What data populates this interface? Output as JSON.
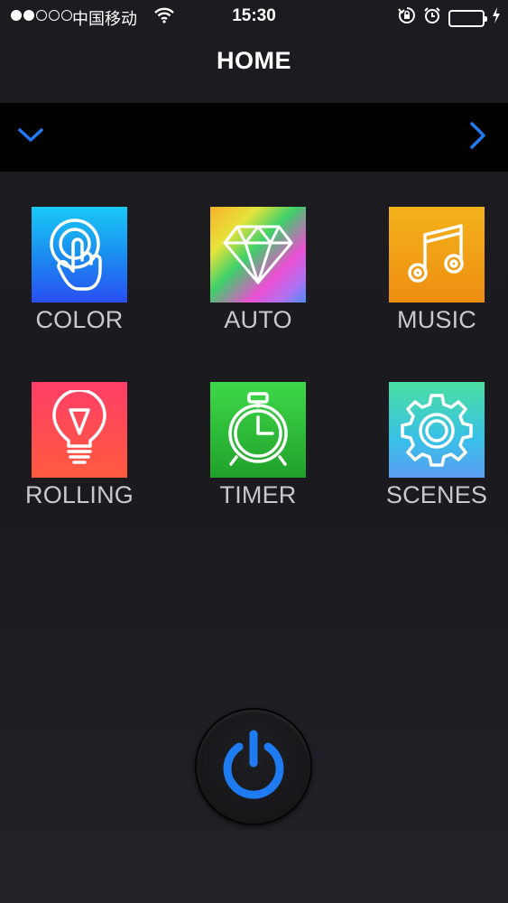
{
  "status_bar": {
    "carrier": "中国移动",
    "time": "15:30"
  },
  "nav": {
    "title": "HOME"
  },
  "tiles": [
    {
      "label": "COLOR",
      "icon": "touch-hand-icon"
    },
    {
      "label": "AUTO",
      "icon": "diamond-icon"
    },
    {
      "label": "MUSIC",
      "icon": "music-note-icon"
    },
    {
      "label": "ROLLING",
      "icon": "light-bulb-icon"
    },
    {
      "label": "TIMER",
      "icon": "alarm-clock-icon"
    },
    {
      "label": "SCENES",
      "icon": "gear-icon"
    }
  ],
  "colors": {
    "accent_blue": "#1e7bf2",
    "battery_green": "#4cd964",
    "label_gray": "#c9c9cc"
  }
}
